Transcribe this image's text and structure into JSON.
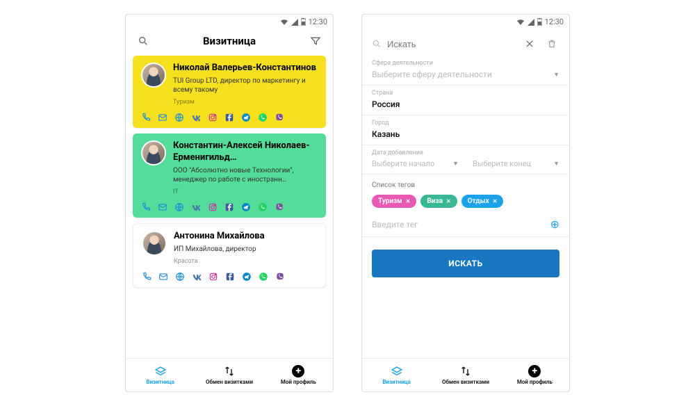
{
  "status": {
    "time": "12:30"
  },
  "screen1": {
    "title": "Визитница",
    "cards": [
      {
        "name": "Николай Валерьев-Константинов",
        "sub": "TUI Group LTD, директор по маркетингу и всему такому",
        "tag": "Туризм"
      },
      {
        "name": "Константин-Алексей Николаев-Ерменигильд…",
        "sub": "ООО \"Абсолютно новые Технологии\", менеджер по работе с иностранн…",
        "tag": "IT"
      },
      {
        "name": "Антонина Михайлова",
        "sub": "ИП Михайлова, директор",
        "tag": "Красота"
      }
    ]
  },
  "screen2": {
    "search_placeholder": "Искать",
    "sphere_label": "Сфера деятельности",
    "sphere_placeholder": "Выберите сферу деятельности",
    "country_label": "Страна",
    "country_value": "Россия",
    "city_label": "Город",
    "city_value": "Казань",
    "date_label": "Дата добавления",
    "date_start": "Выберите начало",
    "date_end": "Выберите конец",
    "tags_label": "Список тегов",
    "tags": [
      "Туризм",
      "Виза",
      "Отдых"
    ],
    "tag_input_placeholder": "Введите тег",
    "search_button": "ИСКАТЬ"
  },
  "nav": {
    "item1": "Визитница",
    "item2": "Обмен визитками",
    "item3": "Мой профиль"
  },
  "action_icons": {
    "phone_color": "#1b8fd6",
    "mail_color": "#1b8fd6",
    "globe_color": "#1b8fd6",
    "vk_color": "#4a76a8",
    "ig_color": "#d6249f",
    "fb_color": "#3b5998",
    "tg_color": "#0088cc",
    "wa_color": "#25d366",
    "viber_color": "#7c529e"
  }
}
